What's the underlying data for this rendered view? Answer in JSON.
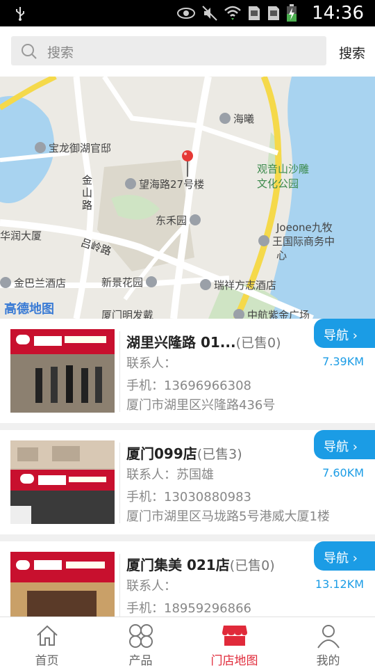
{
  "status": {
    "time": "14:36",
    "icons": [
      "usb-icon",
      "eye-icon",
      "mute-icon",
      "wifi-icon",
      "sim-icon",
      "sim2-icon",
      "battery-charging-icon"
    ]
  },
  "search": {
    "placeholder": "搜索",
    "button": "搜索"
  },
  "map": {
    "labels": {
      "haixi": "海曦",
      "baolong": "宝龙御湖官邸",
      "guanyinshan": "观音山沙雕",
      "guanyinshan2": "文化公园",
      "wanghai": "望海路27号楼",
      "jinshanlu": "金山路",
      "runda": "华润大厦",
      "dongheyuan": "东禾园",
      "joeone": "Joeone九牧",
      "joeone2": "王国际商务中",
      "joeone3": "心",
      "lvling": "吕岭路",
      "jinbalan": "金巴兰酒店",
      "xinjing": "新景花园",
      "ruixiang": "瑞祥方志酒店",
      "amap": "高德地图",
      "mingfa": "厦门明发戴",
      "zhonghang": "中航紫金广场"
    }
  },
  "stores": [
    {
      "name": "湖里兴隆路 01...",
      "sold": "(已售0)",
      "contact": "联系人：",
      "phone": "手机：13696966308",
      "address": "厦门市湖里区兴隆路436号",
      "nav": "导航",
      "distance": "7.39KM"
    },
    {
      "name": "厦门099店",
      "sold": "(已售3)",
      "contact": "联系人：苏国雄",
      "phone": "手机：13030880983",
      "address": "厦门市湖里区马垅路5号港威大厦1楼",
      "nav": "导航",
      "distance": "7.60KM"
    },
    {
      "name": "厦门集美 021店",
      "sold": "(已售0)",
      "contact": "联系人：",
      "phone": "手机：18959296866",
      "address": "",
      "nav": "导航",
      "distance": "13.12KM"
    }
  ],
  "tabs": [
    {
      "label": "首页",
      "icon": "home-icon",
      "active": false
    },
    {
      "label": "产品",
      "icon": "products-icon",
      "active": false
    },
    {
      "label": "门店地图",
      "icon": "store-icon",
      "active": true
    },
    {
      "label": "我的",
      "icon": "profile-icon",
      "active": false
    }
  ],
  "colors": {
    "accent": "#1b9ce5",
    "active_tab": "#e02a3a",
    "store_sign": "#c8102e"
  }
}
